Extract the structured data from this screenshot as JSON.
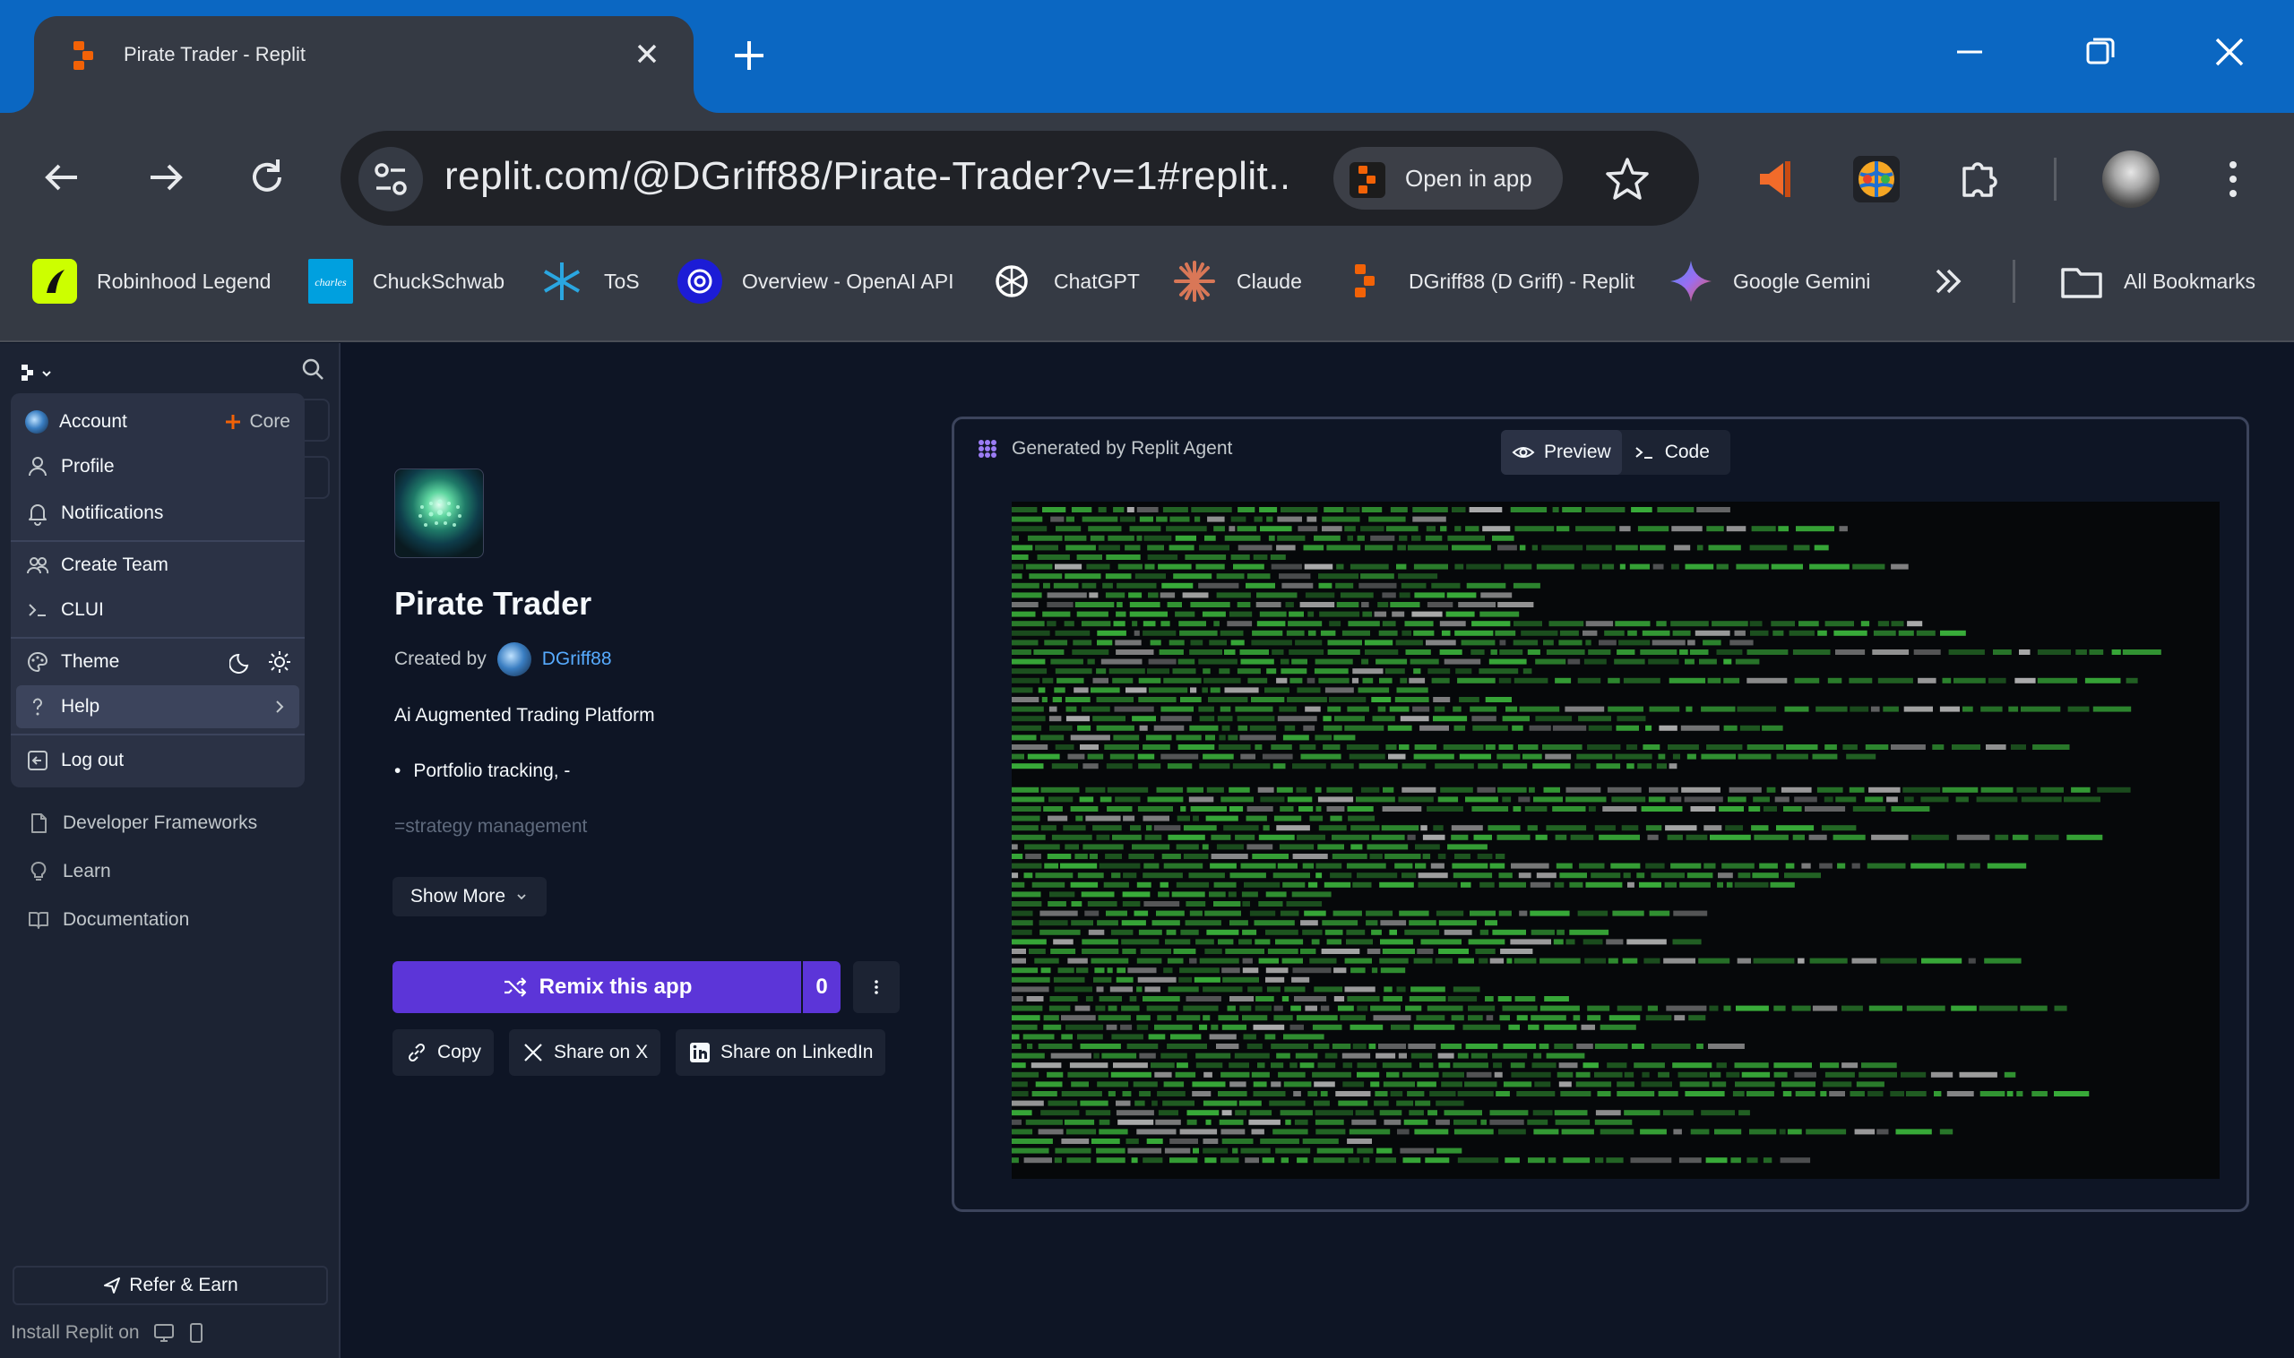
{
  "browser": {
    "tab_title": "Pirate Trader - Replit",
    "url": "replit.com/@DGriff88/Pirate-Trader?v=1#replit....",
    "open_in_app_label": "Open in app",
    "bookmarks": [
      {
        "label": "Robinhood Legend",
        "icon": "robinhood-icon",
        "color": "#ccff00"
      },
      {
        "label": "ChuckSchwab",
        "icon": "schwab-icon",
        "color": "#00a0df"
      },
      {
        "label": "ToS",
        "icon": "thinkorswim-icon",
        "color": "#2aa6e0"
      },
      {
        "label": "Overview - OpenAI API",
        "icon": "openai-icon",
        "color": "#1c1cd6"
      },
      {
        "label": "ChatGPT",
        "icon": "chatgpt-icon",
        "color": "#ffffff"
      },
      {
        "label": "Claude",
        "icon": "claude-icon",
        "color": "#d97757"
      },
      {
        "label": "DGriff88 (D Griff) - Replit",
        "icon": "replit-icon",
        "color": "#f26207"
      },
      {
        "label": "Google Gemini",
        "icon": "gemini-icon",
        "color": "#4e8cf5"
      }
    ],
    "all_bookmarks_label": "All Bookmarks"
  },
  "sidebar": {
    "menu": {
      "account": "Account",
      "plan": "Core",
      "profile": "Profile",
      "notifications": "Notifications",
      "create_team": "Create Team",
      "clui": "CLUI",
      "theme": "Theme",
      "help": "Help",
      "logout": "Log out"
    },
    "links": {
      "developer_frameworks": "Developer Frameworks",
      "learn": "Learn",
      "documentation": "Documentation"
    },
    "refer": "Refer & Earn",
    "install": "Install Replit on"
  },
  "app": {
    "title": "Pirate Trader",
    "created_by_label": "Created by",
    "creator": "DGriff88",
    "description": "Ai Augmented Trading Platform",
    "bullet": "Portfolio tracking, -",
    "faded_line": "=strategy management",
    "show_more": "Show More",
    "remix_label": "Remix this app",
    "remix_count": "0",
    "share": {
      "copy": "Copy",
      "x": "Share on X",
      "linkedin": "Share on LinkedIn"
    }
  },
  "preview": {
    "generated_by": "Generated by Replit Agent",
    "tab_preview": "Preview",
    "tab_code": "Code"
  },
  "colors": {
    "accent": "#5c35d8",
    "link": "#57abff",
    "terminal_green": "#3fbf3f"
  }
}
